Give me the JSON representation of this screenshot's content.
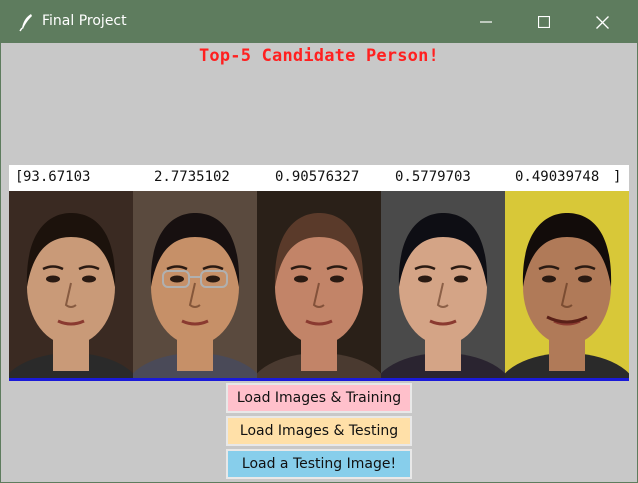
{
  "window": {
    "title": "Final Project",
    "icon": "feather-icon"
  },
  "heading": {
    "text": "Top-5 Candidate Person!",
    "color": "#ff2020"
  },
  "scores": {
    "open_bracket": "[",
    "values": [
      "93.67103",
      "2.7735102",
      "0.90576327",
      "0.5779703",
      "0.49039748"
    ],
    "close_bracket": "]"
  },
  "faces": [
    {
      "name": "face-1",
      "skin": "#c99a78",
      "hair": "#1c120c",
      "shirt": "#2a2a2a",
      "bg": "#3a2a22"
    },
    {
      "name": "face-2",
      "skin": "#c69068",
      "hair": "#171010",
      "shirt": "#4a4a58",
      "bg": "#5a4a3e"
    },
    {
      "name": "face-3",
      "skin": "#c28468",
      "hair": "#5a3a2a",
      "shirt": "#4a3a30",
      "bg": "#2a2018"
    },
    {
      "name": "face-4",
      "skin": "#d4a486",
      "hair": "#0e0e14",
      "shirt": "#2a2430",
      "bg": "#4a4a4a"
    },
    {
      "name": "face-5",
      "skin": "#b07a58",
      "hair": "#120c0a",
      "shirt": "#2a2a2a",
      "bg": "#d8c838"
    }
  ],
  "buttons": [
    {
      "label": "Load Images & Training",
      "color": "#ffc0cb"
    },
    {
      "label": "Load Images & Testing",
      "color": "#ffe0a8"
    },
    {
      "label": "Load a Testing Image!",
      "color": "#87ceeb"
    }
  ],
  "colors": {
    "titlebar": "#5e7c5e",
    "window_bg": "#c8c8c8",
    "divider": "#1a1ad8"
  }
}
